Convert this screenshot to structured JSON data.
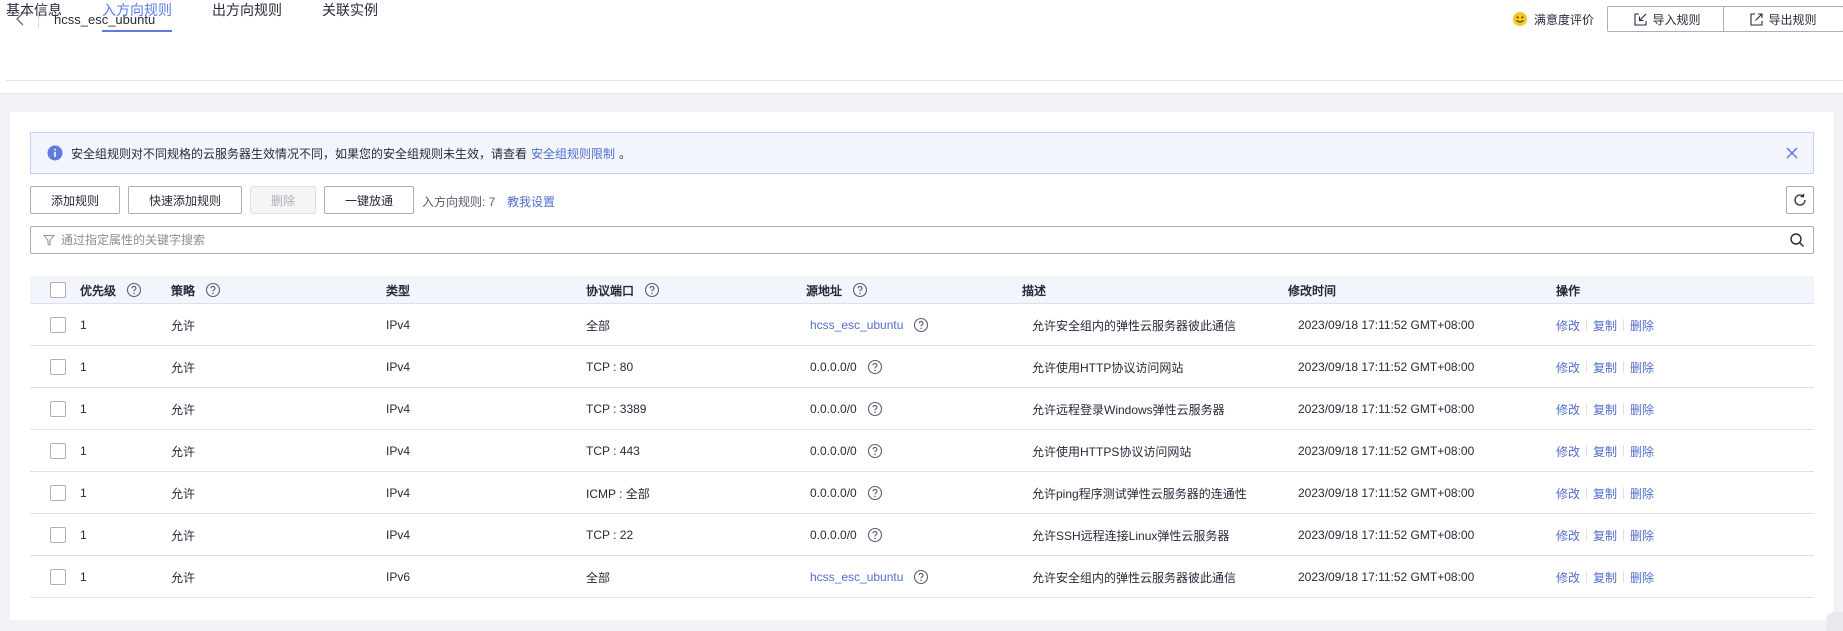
{
  "header": {
    "title": "hcss_esc_ubuntu",
    "satisfaction": "满意度评价",
    "import_label": "导入规则",
    "export_label": "导出规则"
  },
  "tabs": [
    {
      "label": "基本信息"
    },
    {
      "label": "入方向规则"
    },
    {
      "label": "出方向规则"
    },
    {
      "label": "关联实例"
    }
  ],
  "alert": {
    "text": "安全组规则对不同规格的云服务器生效情况不同，如果您的安全组规则未生效，请查看",
    "link": "安全组规则限制",
    "end": "。"
  },
  "toolbar": {
    "add": "添加规则",
    "quick_add": "快速添加规则",
    "delete": "删除",
    "one_click": "一键放通",
    "count": "入方向规则: 7",
    "teach": "教我设置"
  },
  "search": {
    "placeholder": "通过指定属性的关键字搜索"
  },
  "table": {
    "columns": [
      "优先级",
      "策略",
      "类型",
      "协议端口",
      "源地址",
      "描述",
      "修改时间",
      "操作"
    ],
    "rows": [
      {
        "priority": "1",
        "policy": "允许",
        "type": "IPv4",
        "port": "全部",
        "source": "hcss_esc_ubuntu",
        "desc": "允许安全组内的弹性云服务器彼此通信",
        "time": "2023/09/18 17:11:52 GMT+08:00"
      },
      {
        "priority": "1",
        "policy": "允许",
        "type": "IPv4",
        "port": "TCP : 80",
        "source": "0.0.0.0/0",
        "desc": "允许使用HTTP协议访问网站",
        "time": "2023/09/18 17:11:52 GMT+08:00"
      },
      {
        "priority": "1",
        "policy": "允许",
        "type": "IPv4",
        "port": "TCP : 3389",
        "source": "0.0.0.0/0",
        "desc": "允许远程登录Windows弹性云服务器",
        "time": "2023/09/18 17:11:52 GMT+08:00"
      },
      {
        "priority": "1",
        "policy": "允许",
        "type": "IPv4",
        "port": "TCP : 443",
        "source": "0.0.0.0/0",
        "desc": "允许使用HTTPS协议访问网站",
        "time": "2023/09/18 17:11:52 GMT+08:00"
      },
      {
        "priority": "1",
        "policy": "允许",
        "type": "IPv4",
        "port": "ICMP : 全部",
        "source": "0.0.0.0/0",
        "desc": "允许ping程序测试弹性云服务器的连通性",
        "time": "2023/09/18 17:11:52 GMT+08:00"
      },
      {
        "priority": "1",
        "policy": "允许",
        "type": "IPv4",
        "port": "TCP : 22",
        "source": "0.0.0.0/0",
        "desc": "允许SSH远程连接Linux弹性云服务器",
        "time": "2023/09/18 17:11:52 GMT+08:00"
      },
      {
        "priority": "1",
        "policy": "允许",
        "type": "IPv6",
        "port": "全部",
        "source": "hcss_esc_ubuntu",
        "desc": "允许安全组内的弹性云服务器彼此通信",
        "time": "2023/09/18 17:11:52 GMT+08:00"
      }
    ],
    "actions": [
      "修改",
      "复制",
      "删除"
    ]
  },
  "colors": {
    "accent": "#5e7ce0",
    "link": "#526ecc",
    "alert_bg": "#f2f5fc",
    "info_icon": "#5e7ce0",
    "smile": "#f5c324"
  }
}
